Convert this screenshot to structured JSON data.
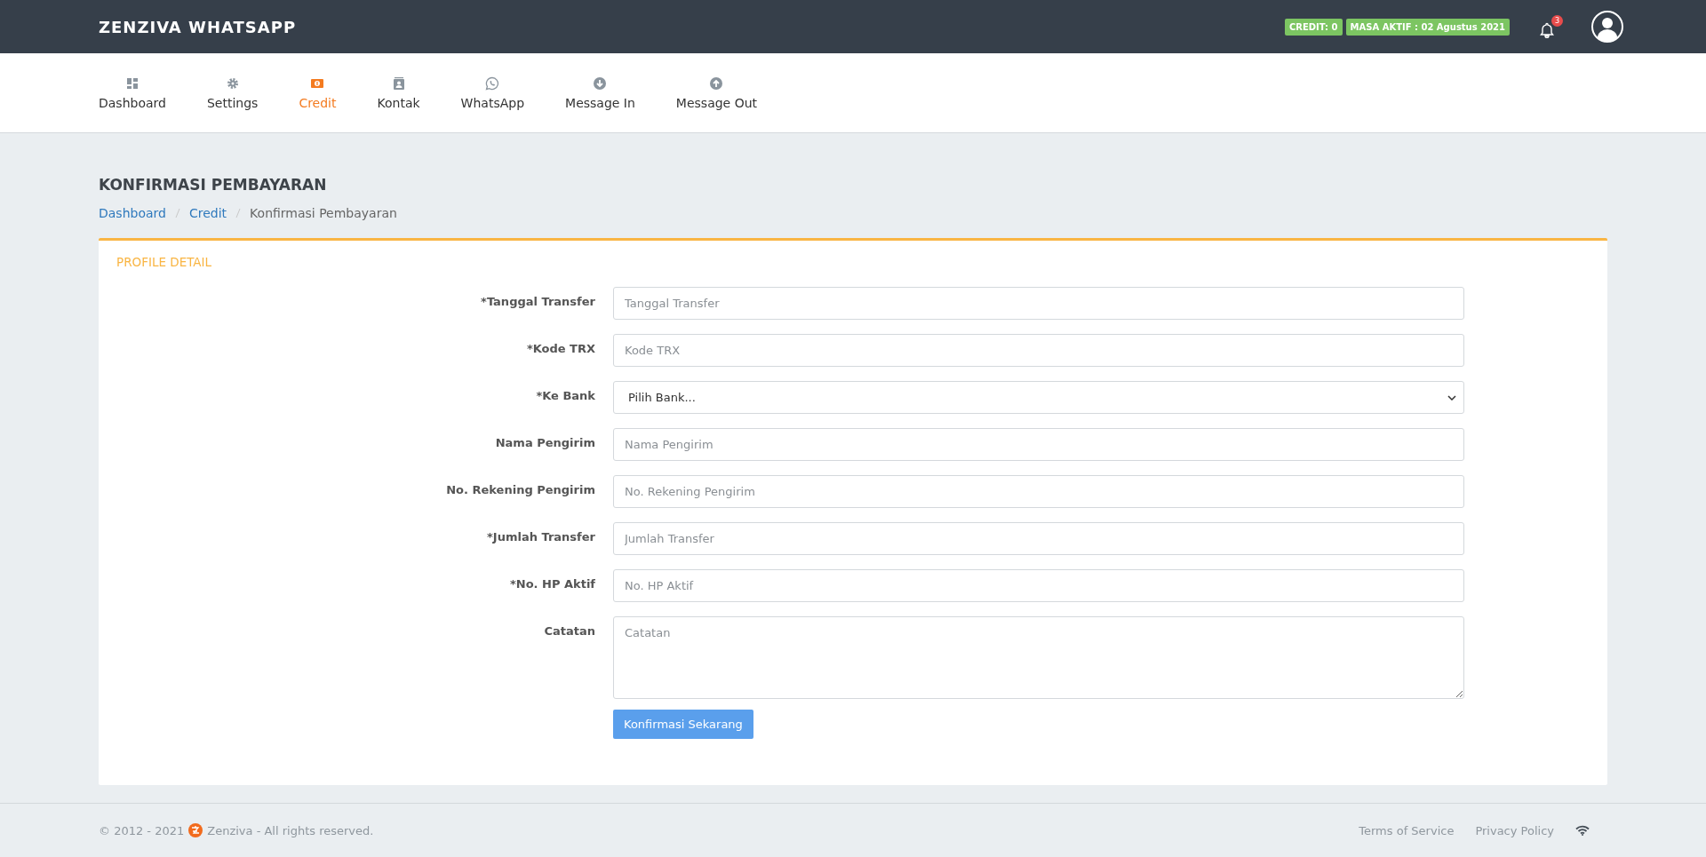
{
  "header": {
    "brand": "ZENZIVA WHATSAPP",
    "badges": [
      "CREDIT: 0",
      "MASA AKTIF : 02 Agustus 2021"
    ],
    "notification_count": "3"
  },
  "nav": [
    {
      "label": "Dashboard",
      "selected": false
    },
    {
      "label": "Settings",
      "selected": false
    },
    {
      "label": "Credit",
      "selected": true
    },
    {
      "label": "Kontak",
      "selected": false
    },
    {
      "label": "WhatsApp",
      "selected": false
    },
    {
      "label": "Message In",
      "selected": false
    },
    {
      "label": "Message Out",
      "selected": false
    }
  ],
  "page": {
    "title": "KONFIRMASI PEMBAYARAN",
    "breadcrumb": [
      {
        "label": "Dashboard",
        "link": true
      },
      {
        "label": "Credit",
        "link": true
      },
      {
        "label": "Konfirmasi Pembayaran",
        "link": false
      }
    ]
  },
  "form": {
    "title": "PROFILE DETAIL",
    "fields": [
      {
        "label": "*Tanggal Transfer",
        "kind": "input",
        "placeholder": "Tanggal Transfer"
      },
      {
        "label": "*Kode TRX",
        "kind": "input",
        "placeholder": "Kode TRX"
      },
      {
        "label": "*Ke Bank",
        "kind": "select",
        "value": "Pilih Bank..."
      },
      {
        "label": "Nama Pengirim",
        "kind": "input",
        "placeholder": "Nama Pengirim"
      },
      {
        "label": "No. Rekening Pengirim",
        "kind": "input",
        "placeholder": "No. Rekening Pengirim"
      },
      {
        "label": "*Jumlah Transfer",
        "kind": "input",
        "placeholder": "Jumlah Transfer"
      },
      {
        "label": "*No. HP Aktif",
        "kind": "input",
        "placeholder": "No. HP Aktif"
      },
      {
        "label": "Catatan",
        "kind": "textarea",
        "placeholder": "Catatan"
      }
    ],
    "submit": "Konfirmasi Sekarang"
  },
  "footer": {
    "copyright": "© 2012 - 2021",
    "company": "Zenziva - All rights reserved.",
    "links": [
      "Terms of Service",
      "Privacy Policy"
    ]
  }
}
